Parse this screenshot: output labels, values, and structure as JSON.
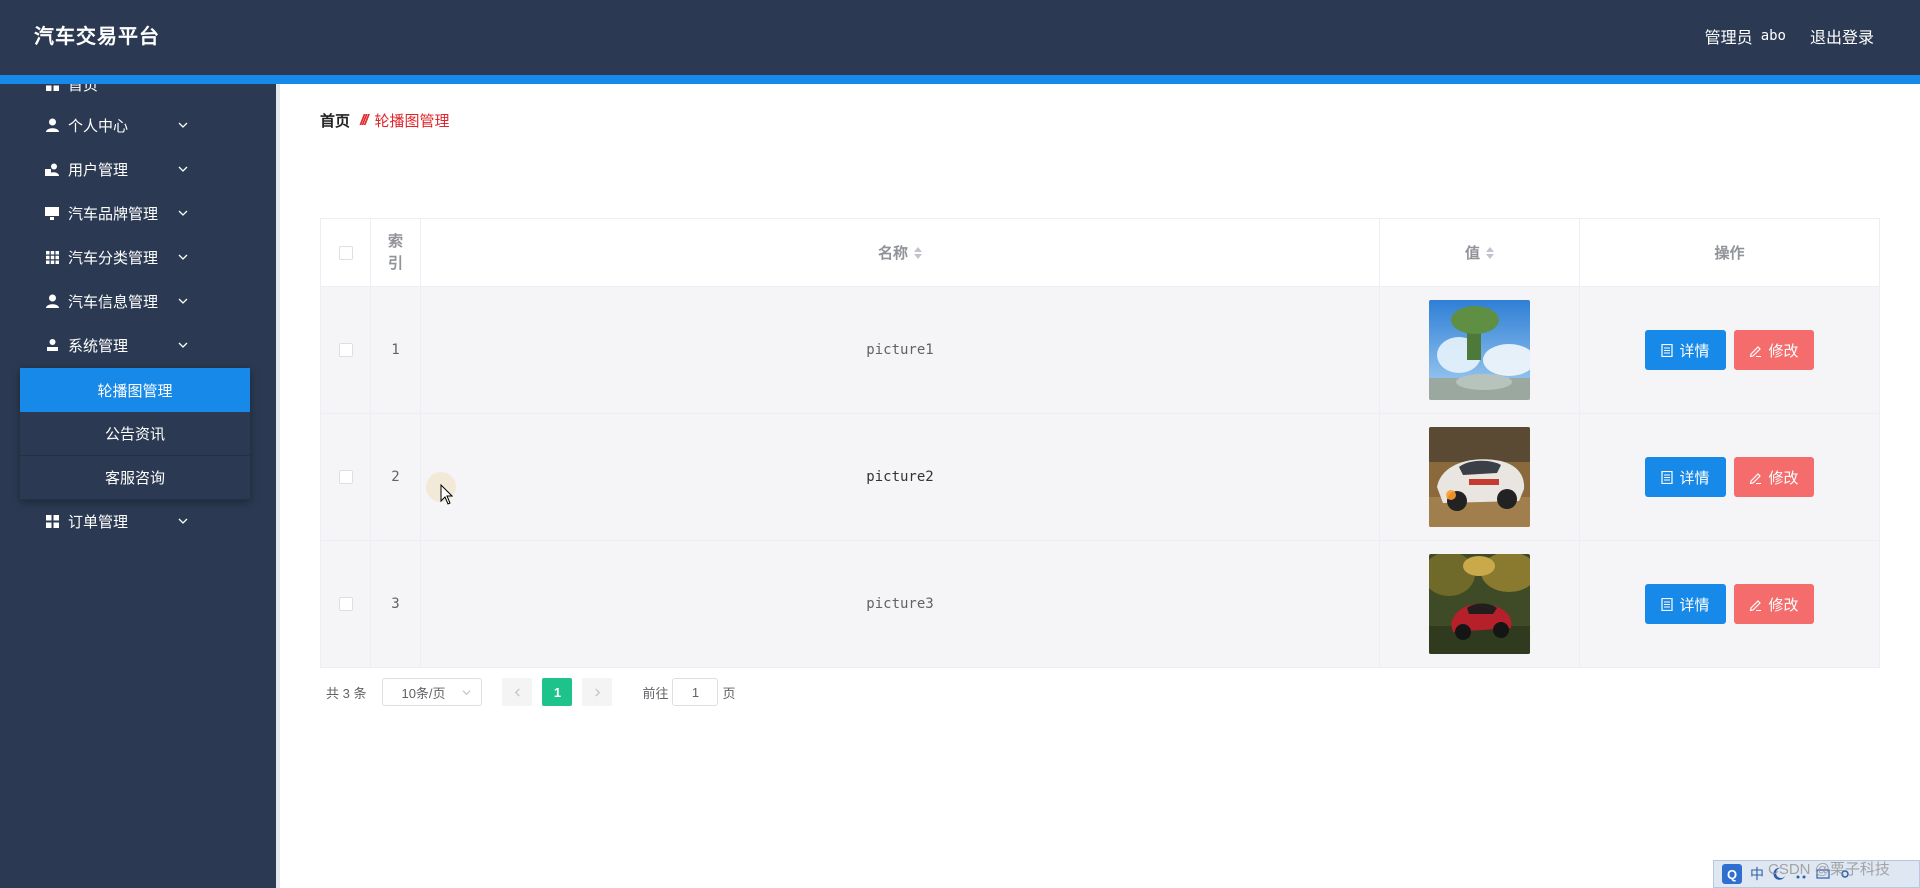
{
  "header": {
    "title": "汽车交易平台",
    "user_role": "管理员",
    "username": "abo",
    "logout": "退出登录"
  },
  "sidebar": {
    "items": [
      {
        "label": "首页",
        "icon": "grid-icon"
      },
      {
        "label": "个人中心",
        "icon": "user-icon"
      },
      {
        "label": "用户管理",
        "icon": "users-icon"
      },
      {
        "label": "汽车品牌管理",
        "icon": "monitor-icon"
      },
      {
        "label": "汽车分类管理",
        "icon": "grid-icon"
      },
      {
        "label": "汽车信息管理",
        "icon": "user-icon"
      },
      {
        "label": "系统管理",
        "icon": "user-icon"
      },
      {
        "label": "订单管理",
        "icon": "grid-icon"
      }
    ],
    "submenu": [
      {
        "label": "轮播图管理",
        "active": true
      },
      {
        "label": "公告资讯",
        "active": false
      },
      {
        "label": "客服咨询",
        "active": false
      }
    ]
  },
  "breadcrumb": {
    "home": "首页",
    "current": "轮播图管理"
  },
  "table": {
    "columns": {
      "index_line1": "索",
      "index_line2": "引",
      "name": "名称",
      "value": "值",
      "action": "操作"
    },
    "rows": [
      {
        "index": "1",
        "name": "picture1",
        "image": "car-image-1"
      },
      {
        "index": "2",
        "name": "picture2",
        "image": "car-image-2"
      },
      {
        "index": "3",
        "name": "picture3",
        "image": "car-image-3"
      }
    ],
    "detail_label": "详情",
    "edit_label": "修改"
  },
  "pagination": {
    "total": "共 3 条",
    "page_size": "10条/页",
    "current_page": "1",
    "goto_prefix": "前往",
    "goto_value": "1",
    "goto_suffix": "页"
  },
  "tray": {
    "ime_label": "中"
  },
  "watermark": "CSDN @栗子科技"
}
